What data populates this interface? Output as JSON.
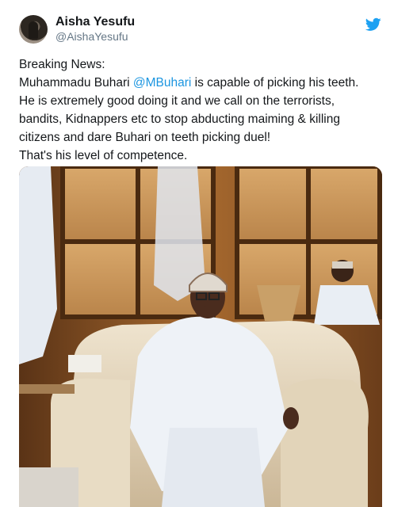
{
  "tweet": {
    "display_name": "Aisha Yesufu",
    "handle": "@AishaYesufu",
    "avatar_icon": "user-avatar",
    "platform_icon": "twitter-bird-icon",
    "brand_color": "#1b95e0",
    "text": {
      "line1": "Breaking News:",
      "line2_prefix": "Muhammadu Buhari ",
      "mention": "@MBuhari",
      "line2_suffix": " is capable of picking his teeth.",
      "line3": "He is extremely good doing it and we call on the terrorists,",
      "line4": "bandits, Kidnappers etc to stop abducting maiming & killing",
      "line5": "citizens and dare Buhari on teeth picking duel!",
      "line6": "That's his level of competence."
    },
    "photo": {
      "subject": "man-in-white-robe-seated-in-armchair"
    }
  }
}
